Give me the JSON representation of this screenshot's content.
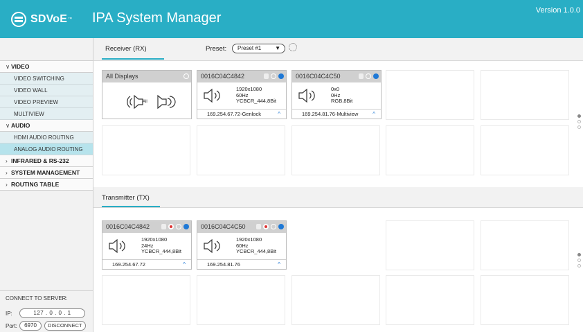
{
  "header": {
    "logo_text": "SDVoE",
    "logo_tm": "™",
    "title": "IPA System Manager",
    "version": "Version 1.0.0",
    "background": "#29aec5"
  },
  "sidebar": {
    "video": {
      "label": "VIDEO",
      "items": [
        "VIDEO SWITCHING",
        "VIDEO WALL",
        "VIDEO PREVIEW",
        "MULTIVIEW"
      ]
    },
    "audio": {
      "label": "AUDIO",
      "items": [
        "HDMI AUDIO ROUTING",
        "ANALOG AUDIO ROUTING"
      ],
      "active_item": "ANALOG AUDIO ROUTING"
    },
    "other_sections": [
      "INFRARED & RS-232",
      "SYSTEM MANAGEMENT",
      "ROUTING TABLE"
    ],
    "server": {
      "title": "CONNECT TO SERVER:",
      "ip_label": "IP:",
      "ip_value": "127 . 0 . 0 . 1",
      "port_label": "Port:",
      "port_value": "6970",
      "disconnect_label": "DISCONNECT"
    }
  },
  "receiver": {
    "tab": "Receiver (RX)",
    "preset_label": "Preset:",
    "preset_value": "Preset #1",
    "cards": [
      {
        "title": "All Displays",
        "all_label": "All"
      },
      {
        "title": "0016C04C4842",
        "res": "1920x1080",
        "hz": "60Hz",
        "fmt": "YCBCR_444,8Bit",
        "ip": "169.254.67.72-Genlock"
      },
      {
        "title": "0016C04C4C50",
        "res": "0x0",
        "hz": "0Hz",
        "fmt": "RGB,8Bit",
        "ip": "169.254.81.76-Multiview"
      }
    ]
  },
  "transmitter": {
    "tab": "Transmitter (TX)",
    "cards": [
      {
        "title": "0016C04C4842",
        "res": "1920x1080",
        "hz": "24Hz",
        "fmt": "YCBCR_444,8Bit",
        "ip": "169.254.67.72"
      },
      {
        "title": "0016C04C4C50",
        "res": "1920x1080",
        "hz": "60Hz",
        "fmt": "YCBCR_444,8Bit",
        "ip": "169.254.81.76"
      }
    ]
  },
  "icons": [
    "gear-icon",
    "lock-icon",
    "record-icon",
    "status-dot-icon",
    "speaker-icon",
    "chevron-up-icon",
    "chevron-down-icon",
    "chevron-right-icon"
  ],
  "colors": {
    "accent": "#29aec5",
    "active_item": "#b6e3ec",
    "status_blue": "#1e78d6",
    "record_red": "#d33333"
  }
}
